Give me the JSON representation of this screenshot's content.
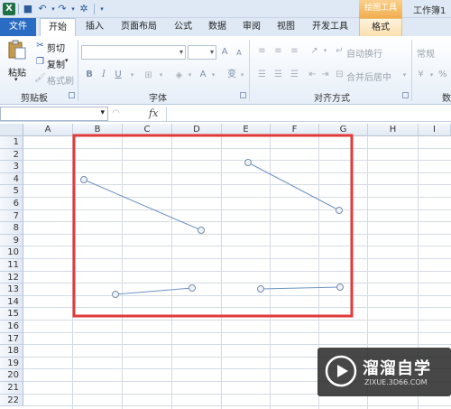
{
  "title_bar": {
    "app_icon": "X",
    "context_tab_group": "绘图工具",
    "workbook_title": "工作簿1"
  },
  "tabs": [
    {
      "label": "文件"
    },
    {
      "label": "开始"
    },
    {
      "label": "插入"
    },
    {
      "label": "页面布局"
    },
    {
      "label": "公式"
    },
    {
      "label": "数据"
    },
    {
      "label": "审阅"
    },
    {
      "label": "视图"
    },
    {
      "label": "开发工具"
    },
    {
      "label": "格式"
    }
  ],
  "ribbon": {
    "clipboard": {
      "paste": "粘贴",
      "cut": "剪切",
      "copy": "复制",
      "format_painter": "格式刷",
      "group_label": "剪贴板"
    },
    "font": {
      "bold": "B",
      "italic": "I",
      "underline": "U",
      "grow": "A",
      "shrink": "A",
      "font_color": "A",
      "phonetic": "变",
      "group_label": "字体"
    },
    "alignment": {
      "wrap_text": "自动换行",
      "merge_center": "合并后居中",
      "group_label": "对齐方式"
    },
    "number": {
      "format": "常规",
      "percent": "%",
      "group_label": "数"
    }
  },
  "formula_bar": {
    "fx": "fx"
  },
  "grid": {
    "columns": [
      "A",
      "B",
      "C",
      "D",
      "E",
      "F",
      "G",
      "H",
      "I"
    ],
    "rows": [
      "1",
      "2",
      "3",
      "4",
      "5",
      "6",
      "7",
      "8",
      "9",
      "10",
      "11",
      "12",
      "13",
      "14",
      "15",
      "16",
      "17",
      "18",
      "19",
      "20",
      "21",
      "22"
    ]
  },
  "colors": {
    "highlight_box": "#e03a3a",
    "line_stroke": "#6d93c4",
    "file_tab": "#2a6cc3"
  },
  "watermark": {
    "title": "溜溜自学",
    "url": "ZIXUE.3D66.COM"
  }
}
